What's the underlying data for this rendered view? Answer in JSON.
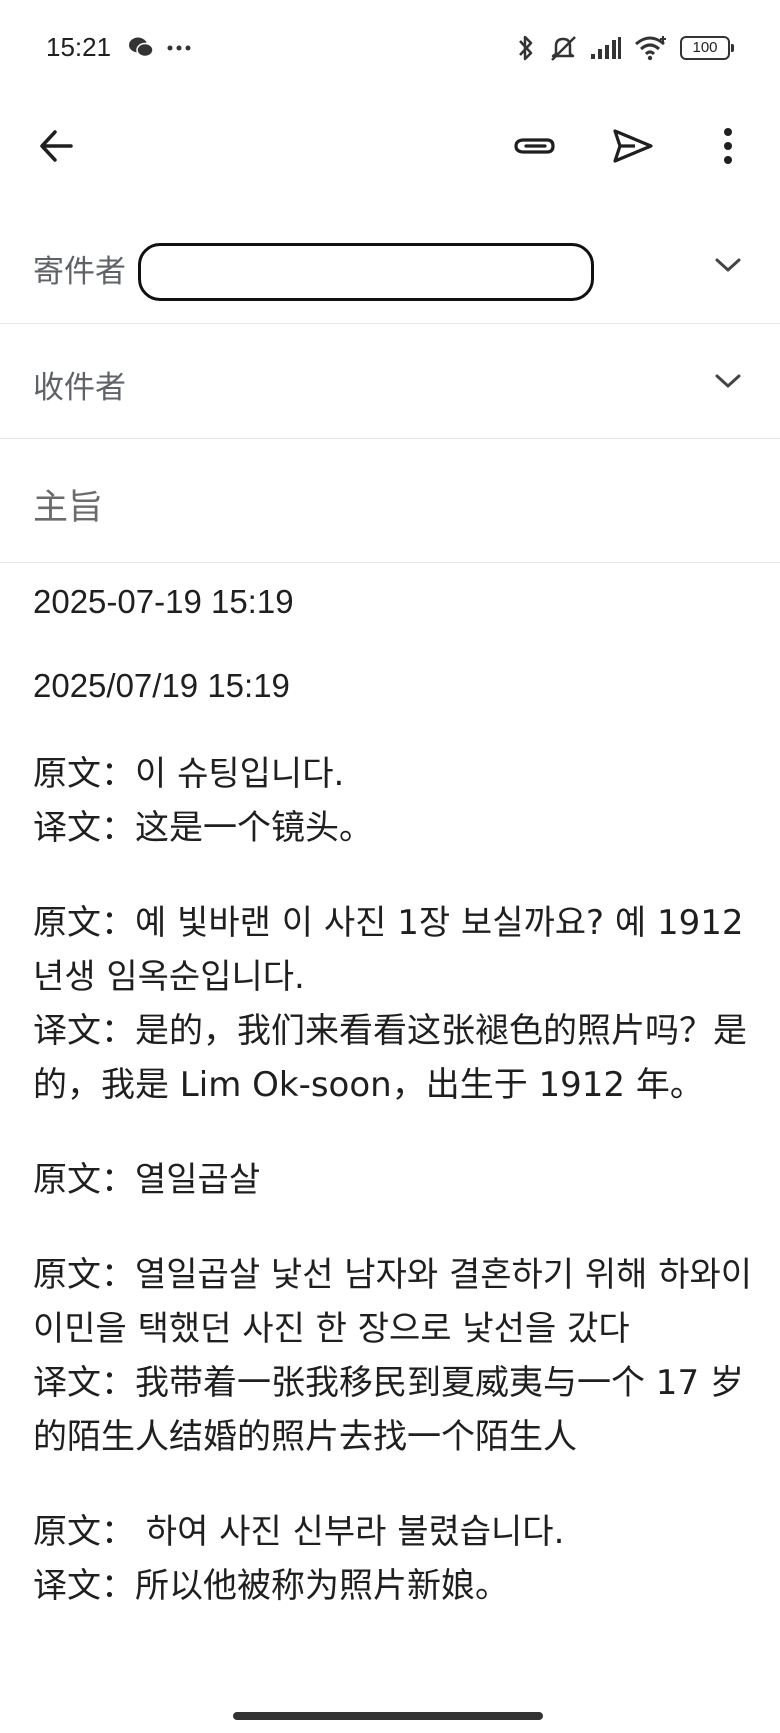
{
  "status_bar": {
    "time": "15:21",
    "left_icons": [
      "wechat-icon",
      "more-dots-icon"
    ],
    "right_icons": [
      "bluetooth-icon",
      "mute-icon",
      "signal-icon",
      "wifi-icon",
      "battery-icon"
    ],
    "battery": "100"
  },
  "toolbar": {
    "back_icon": "arrow-left-icon",
    "attach_icon": "paperclip-icon",
    "send_icon": "send-icon",
    "more_icon": "more-vert-icon"
  },
  "compose": {
    "from_label": "寄件者",
    "from_value": "",
    "to_label": "收件者",
    "subject_placeholder": "主旨"
  },
  "body": {
    "date1": "2025-07-19 15:19",
    "date2": "2025/07/19 15:19",
    "paragraphs": [
      "原文：이 슈팅입니다.\n译文：这是一个镜头。",
      "原文：예 빛바랜 이 사진 1장 보실까요? 예 1912년생 임옥순입니다.\n译文：是的，我们来看看这张褪色的照片吗？是的，我是 Lim Ok-soon，出生于 1912 年。",
      "原文：열일곱살",
      "原文：열일곱살 낯선 남자와 결혼하기 위해 하와이 이민을 택했던 사진 한 장으로 낯선을 갔다\n译文：我带着一张我移民到夏威夷与一个 17 岁的陌生人结婚的照片去找一个陌生人",
      "原文： 하여 사진 신부라 불렸습니다.\n译文：所以他被称为照片新娘。"
    ]
  }
}
